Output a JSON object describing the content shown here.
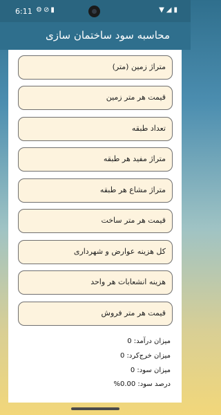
{
  "status_bar": {
    "time": "6:11",
    "left_icons": [
      "settings-icon",
      "block-icon",
      "sim-icon"
    ],
    "right_icons": [
      "wifi-icon",
      "signal-icon",
      "battery-icon"
    ]
  },
  "app_bar": {
    "title": "محاسبه سود ساختمان سازی"
  },
  "form": {
    "fields": [
      {
        "label": "متراژ زمین (متر)"
      },
      {
        "label": "قیمت هر متر زمین"
      },
      {
        "label": "تعداد طبقه"
      },
      {
        "label": "متراژ مفید هر طبقه"
      },
      {
        "label": "متراژ مشاع هر طبقه"
      },
      {
        "label": "قیمت هر متر ساخت"
      },
      {
        "label": "کل هزینه عوارض و شهرداری"
      },
      {
        "label": "هزینه انشعابات هر واحد"
      },
      {
        "label": "قیمت هر متر فروش"
      }
    ]
  },
  "results": {
    "income": "میزان درآمد: 0",
    "expense": "میزان خرج‌کرد: 0",
    "profit": "میزان سود: 0",
    "profit_percent": "درصد سود: 0.00%"
  },
  "colors": {
    "app_bar": "#2f6f8d",
    "field_bg": "#fdf3de",
    "field_border": "#6f6f6f"
  }
}
